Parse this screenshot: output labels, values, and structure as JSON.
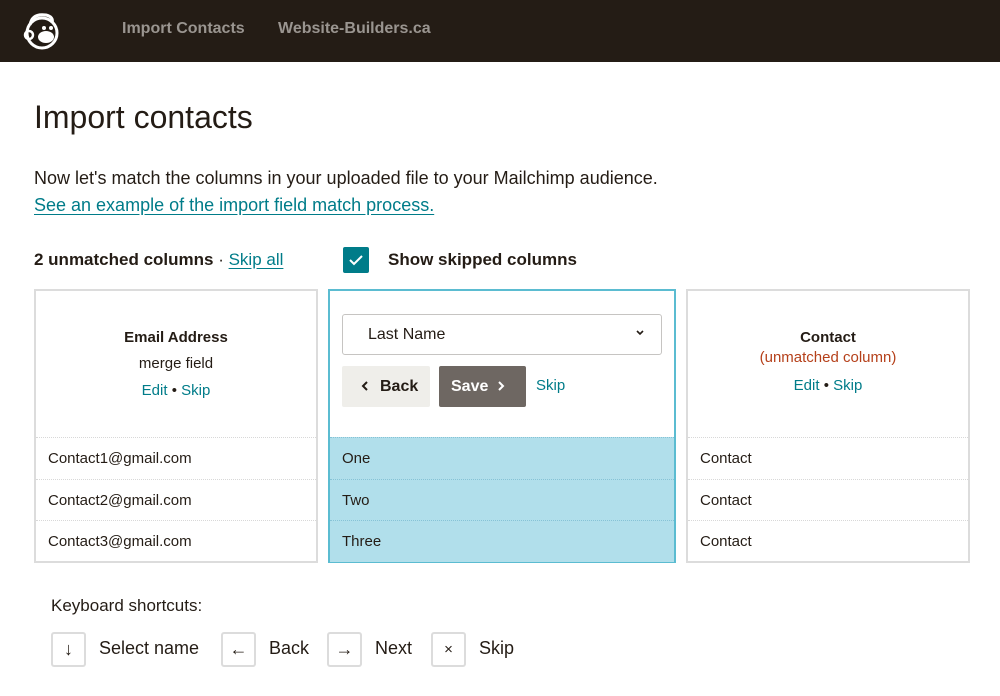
{
  "header": {
    "logo": "mailchimp-freddie-logo",
    "nav": [
      {
        "label": "Import Contacts"
      },
      {
        "label": "Website-Builders.ca"
      }
    ]
  },
  "page": {
    "title": "Import contacts",
    "intro": "Now let's match the columns in your uploaded file to your Mailchimp audience.",
    "example_link": "See an example of the import field match process."
  },
  "summary": {
    "unmatched": "2 unmatched columns",
    "separator": " · ",
    "skip_all": "Skip all",
    "show_skipped_label": "Show skipped columns",
    "show_skipped_checked": true
  },
  "columns": [
    {
      "title": "Email Address",
      "subtitle": "merge field",
      "edit": "Edit",
      "bullet": " • ",
      "skip": "Skip",
      "rows": [
        "Contact1@gmail.com",
        "Contact2@gmail.com",
        "Contact3@gmail.com"
      ]
    },
    {
      "select_value": "Last Name",
      "back": "Back",
      "save": "Save",
      "skip": "Skip",
      "rows": [
        "One",
        "Two",
        "Three"
      ]
    },
    {
      "title": "Contact",
      "subtitle": "(unmatched column)",
      "edit": "Edit",
      "bullet": " • ",
      "skip": "Skip",
      "rows": [
        "Contact",
        "Contact",
        "Contact"
      ]
    }
  ],
  "shortcuts": {
    "title": "Keyboard shortcuts:",
    "items": [
      {
        "key": "↓",
        "label": "Select name"
      },
      {
        "key": "←",
        "label": "Back"
      },
      {
        "key": "→",
        "label": "Next"
      },
      {
        "key": "×",
        "label": "Skip"
      }
    ]
  },
  "colors": {
    "header_bg": "#241c15",
    "link": "#007c89",
    "active_border": "#5bbcd1",
    "active_fill": "#b1dfeb",
    "warning": "#b5401a",
    "save_button": "#6e6762"
  }
}
